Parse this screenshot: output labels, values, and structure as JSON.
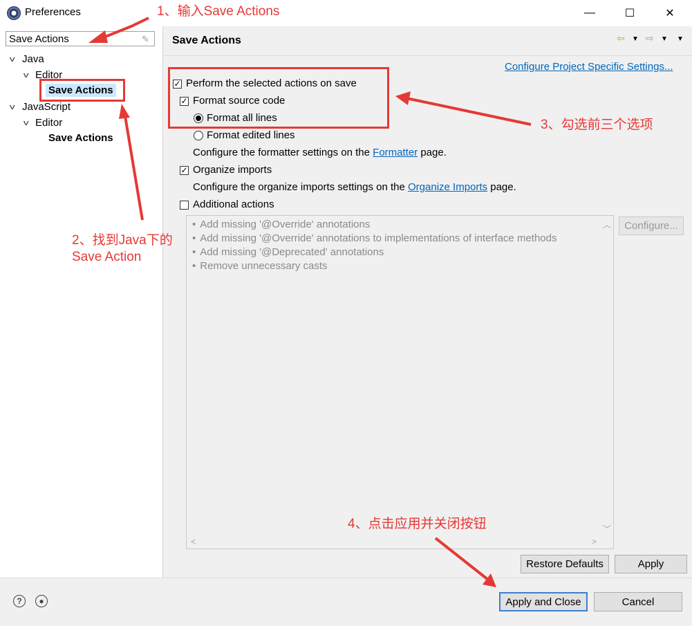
{
  "window": {
    "title": "Preferences",
    "icon": "eclipse-icon"
  },
  "window_controls": {
    "minimize": "—",
    "maximize": "☐",
    "close": "✕"
  },
  "filter": {
    "value": "Save Actions",
    "clear_icon": "clear-filter-icon"
  },
  "tree": {
    "java": "Java",
    "java_editor": "Editor",
    "java_save_actions": "Save Actions",
    "javascript": "JavaScript",
    "js_editor": "Editor",
    "js_save_actions": "Save Actions"
  },
  "page": {
    "title": "Save Actions",
    "project_settings_link": "Configure Project Specific Settings...",
    "perform_label": "Perform the selected actions on save",
    "perform_checked": true,
    "format_source_label": "Format source code",
    "format_source_checked": true,
    "format_all_label": "Format all lines",
    "format_all_selected": true,
    "format_edited_label": "Format edited lines",
    "formatter_text_pre": "Configure the formatter settings on the ",
    "formatter_link": "Formatter",
    "formatter_text_post": " page.",
    "organize_label": "Organize imports",
    "organize_checked": true,
    "organize_text_pre": "Configure the organize imports settings on the ",
    "organize_link": "Organize Imports",
    "organize_text_post": " page.",
    "additional_label": "Additional actions",
    "additional_checked": false,
    "additional_items": [
      "Add missing '@Override' annotations",
      "Add missing '@Override' annotations to implementations of interface methods",
      "Add missing '@Deprecated' annotations",
      "Remove unnecessary casts"
    ],
    "configure_button": "Configure..."
  },
  "buttons": {
    "restore_defaults": "Restore Defaults",
    "apply": "Apply",
    "apply_and_close": "Apply and Close",
    "cancel": "Cancel"
  },
  "annotations": {
    "step1": "1、输入Save Actions",
    "step2_line1": "2、找到Java下的",
    "step2_line2": "Save Action",
    "step3": "3、勾选前三个选项",
    "step4": "4、点击应用并关闭按钮"
  },
  "colors": {
    "annotation_red": "#e53935",
    "link_blue": "#0066bb",
    "selection_blue": "#cce8ff"
  }
}
